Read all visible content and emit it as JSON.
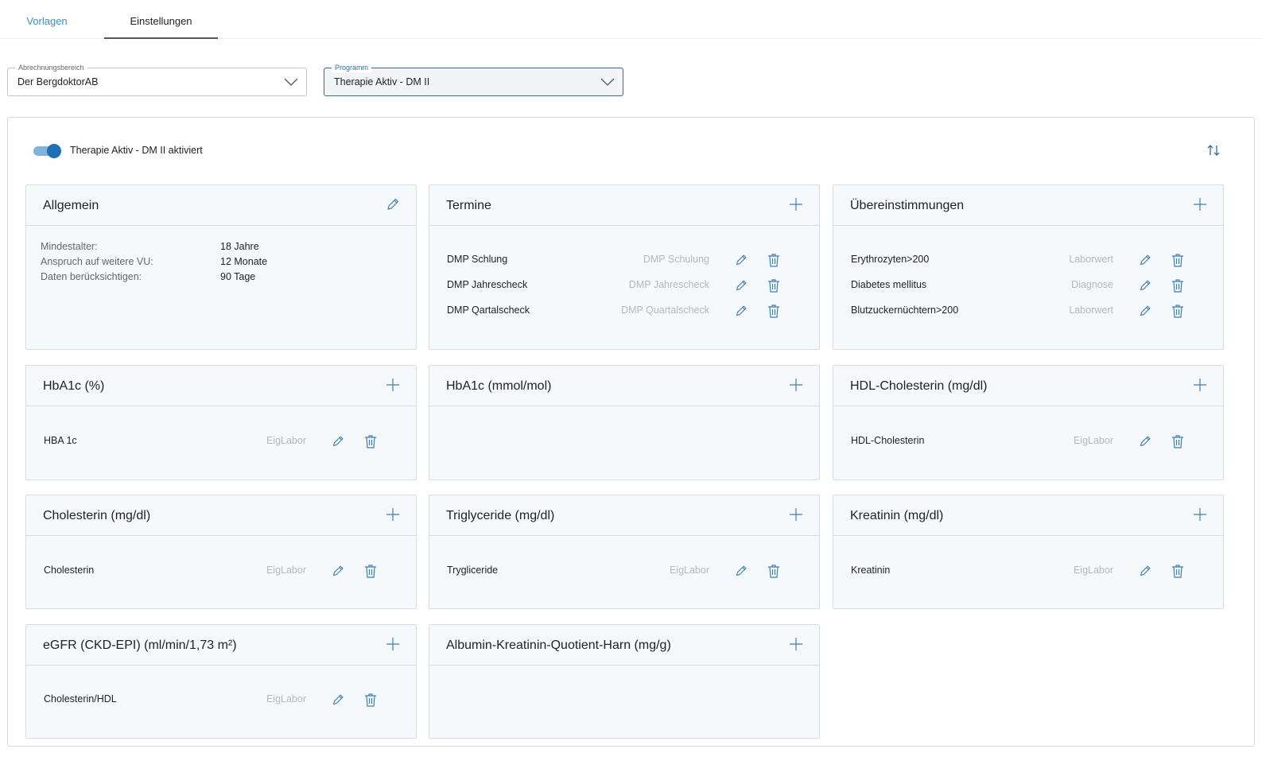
{
  "tabs": [
    {
      "label": "Vorlagen",
      "active": false
    },
    {
      "label": "Einstellungen",
      "active": true
    }
  ],
  "selects": {
    "abrechnungsbereich": {
      "legend": "Abrechnungsbereich",
      "value": "Der BergdoktorAB"
    },
    "programm": {
      "legend": "Programm",
      "value": "Therapie Aktiv - DM II"
    }
  },
  "toggle": {
    "label": "Therapie Aktiv - DM II aktiviert",
    "checked": true
  },
  "colors": {
    "accent": "#1f6fb5",
    "card_bg": "#f5f9fc",
    "muted_text": "#b4b8bd"
  },
  "cards": {
    "allgemein": {
      "title": "Allgemein",
      "action_icon": "pencil-icon",
      "fields": [
        {
          "label": "Mindestalter:",
          "value": "18 Jahre"
        },
        {
          "label": "Anspruch auf weitere VU:",
          "value": "12 Monate"
        },
        {
          "label": "Daten berücksichtigen:",
          "value": "90 Tage"
        }
      ]
    },
    "termine": {
      "title": "Termine",
      "action_icon": "plus-icon",
      "rows": [
        {
          "name": "DMP Schlung",
          "category": "DMP Schulung"
        },
        {
          "name": "DMP Jahrescheck",
          "category": "DMP Jahrescheck"
        },
        {
          "name": "DMP Qartalscheck",
          "category": "DMP Quartalscheck"
        }
      ]
    },
    "uebereinstimmungen": {
      "title": "Übereinstimmungen",
      "action_icon": "plus-icon",
      "rows": [
        {
          "name": "Erythrozyten>200",
          "category": "Laborwert"
        },
        {
          "name": "Diabetes mellitus",
          "category": "Diagnose"
        },
        {
          "name": "Blutzuckernüchtern>200",
          "category": "Laborwert"
        }
      ]
    },
    "hba1c_pct": {
      "title": "HbA1c (%)",
      "action_icon": "plus-icon",
      "rows": [
        {
          "name": "HBA 1c",
          "category": "EigLabor"
        }
      ]
    },
    "hba1c_mmol": {
      "title": "HbA1c (mmol/mol)",
      "action_icon": "plus-icon",
      "rows": []
    },
    "hdl": {
      "title": "HDL-Cholesterin (mg/dl)",
      "action_icon": "plus-icon",
      "rows": [
        {
          "name": "HDL-Cholesterin",
          "category": "EigLabor"
        }
      ]
    },
    "cholesterin": {
      "title": "Cholesterin (mg/dl)",
      "action_icon": "plus-icon",
      "rows": [
        {
          "name": "Cholesterin",
          "category": "EigLabor"
        }
      ]
    },
    "triglyceride": {
      "title": "Triglyceride (mg/dl)",
      "action_icon": "plus-icon",
      "rows": [
        {
          "name": "Trygliceride",
          "category": "EigLabor"
        }
      ]
    },
    "kreatinin": {
      "title": "Kreatinin (mg/dl)",
      "action_icon": "plus-icon",
      "rows": [
        {
          "name": "Kreatinin",
          "category": "EigLabor"
        }
      ]
    },
    "egfr": {
      "title": "eGFR (CKD-EPI) (ml/min/1,73 m²)",
      "action_icon": "plus-icon",
      "rows": [
        {
          "name": "Cholesterin/HDL",
          "category": "EigLabor"
        }
      ]
    },
    "albumin": {
      "title": "Albumin-Kreatinin-Quotient-Harn (mg/g)",
      "action_icon": "plus-icon",
      "rows": []
    }
  }
}
